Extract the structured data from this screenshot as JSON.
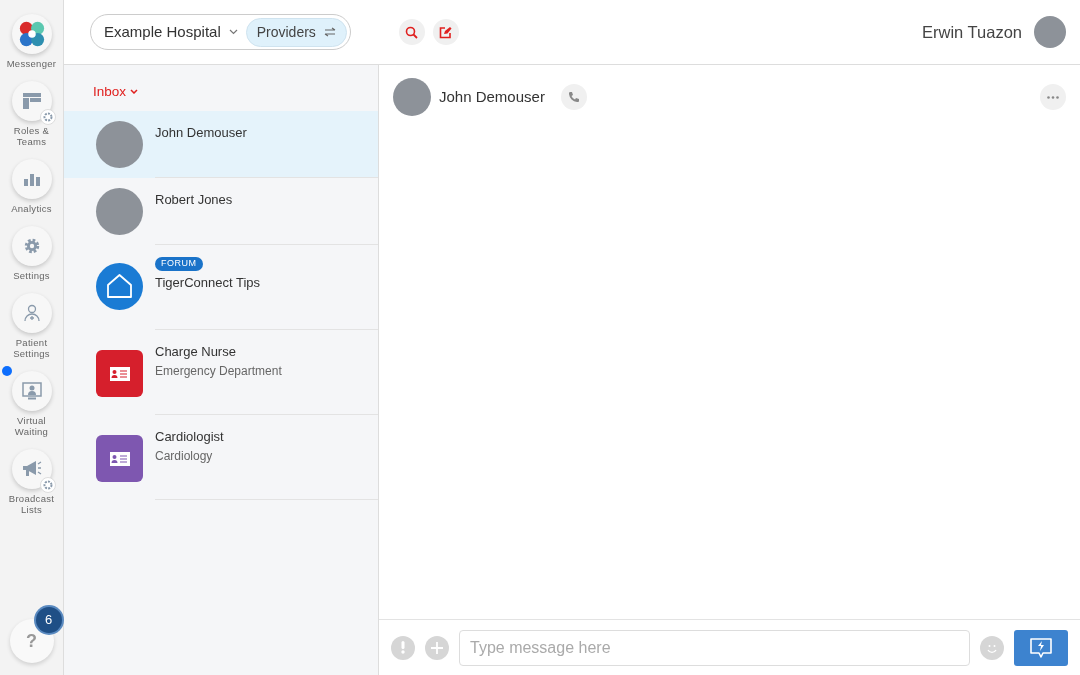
{
  "rail": {
    "items": [
      {
        "kind": "logo",
        "label": "Messenger",
        "notified": false
      },
      {
        "kind": "roles",
        "label": "Roles & Teams",
        "notified": false
      },
      {
        "kind": "analytics",
        "label": "Analytics",
        "notified": false
      },
      {
        "kind": "settings",
        "label": "Settings",
        "notified": false
      },
      {
        "kind": "patient",
        "label": "Patient Settings",
        "notified": false
      },
      {
        "kind": "virtual",
        "label": "Virtual Waiting",
        "notified": true
      },
      {
        "kind": "broadcast",
        "label": "Broadcast Lists",
        "notified": false
      }
    ],
    "help": {
      "label": "?",
      "badge": "6"
    }
  },
  "header": {
    "organization": "Example Hospital",
    "network": "Providers",
    "user": "Erwin Tuazon"
  },
  "inbox": {
    "title": "Inbox",
    "conversations": [
      {
        "kind": "person",
        "name": "John Demouser",
        "selected": true
      },
      {
        "kind": "person",
        "name": "Robert Jones",
        "selected": false
      },
      {
        "kind": "forum",
        "tag": "FORUM",
        "name": "TigerConnect Tips",
        "selected": false
      },
      {
        "kind": "role",
        "name": "Charge Nurse",
        "subtitle": "Emergency Department",
        "color": "#d61f2c",
        "selected": false
      },
      {
        "kind": "role",
        "name": "Cardiologist",
        "subtitle": "Cardiology",
        "color": "#7e57b0",
        "selected": false
      }
    ]
  },
  "chat": {
    "name": "John Demouser",
    "composer": {
      "placeholder": "Type message here"
    }
  }
}
